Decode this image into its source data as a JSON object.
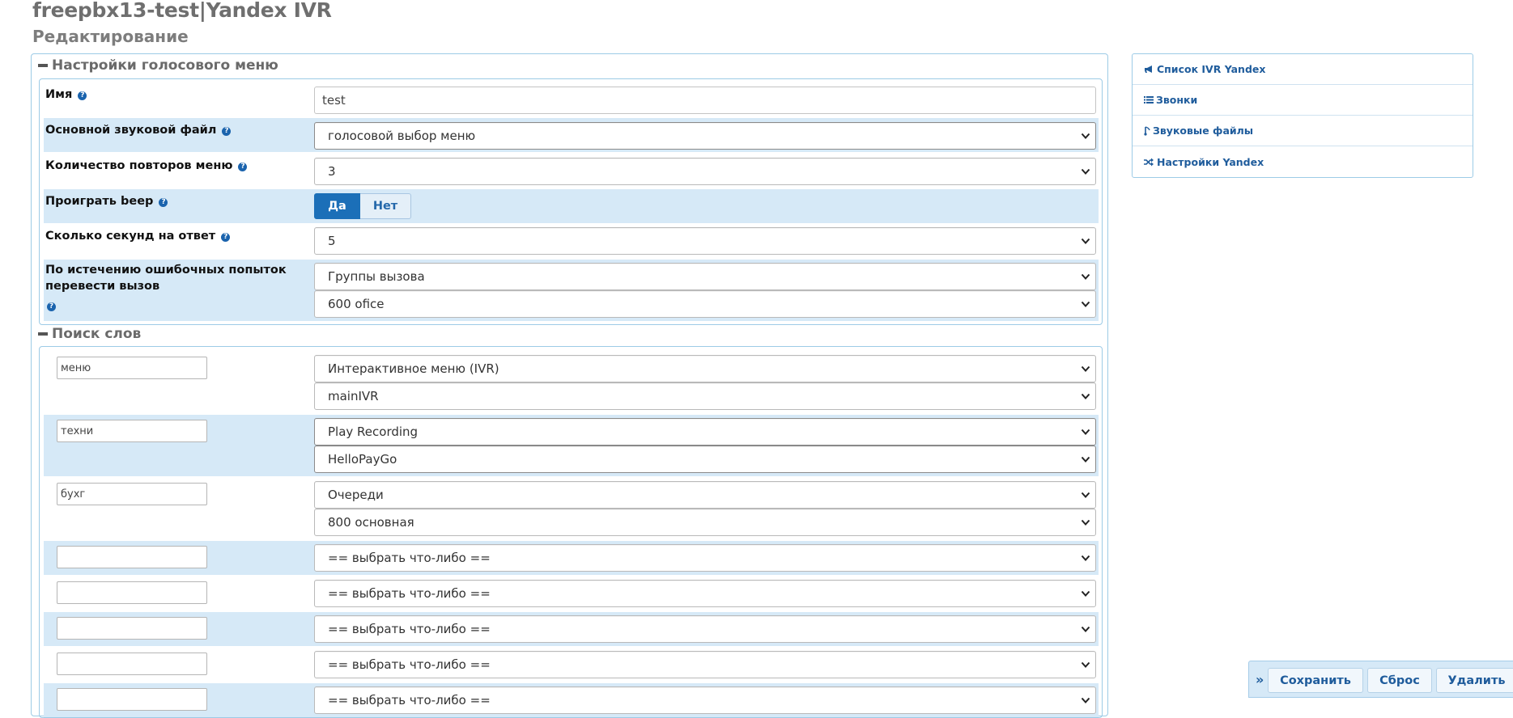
{
  "header": {
    "title": "freepbx13-test|Yandex IVR",
    "subtitle": "Редактирование"
  },
  "settings": {
    "legend": "Настройки голосового меню",
    "name_label": "Имя",
    "name_value": "test",
    "sound_label": "Основной звуковой файл",
    "sound_value": "голосовой выбор меню",
    "repeats_label": "Количество повторов меню",
    "repeats_value": "3",
    "beep_label": "Проиграть beep",
    "beep_yes": "Да",
    "beep_no": "Нет",
    "beep_selected": "Да",
    "timeout_label": "Сколько секунд на ответ",
    "timeout_value": "5",
    "failover_label_line1": "По истечению ошибочных попыток",
    "failover_label_line2": "перевести вызов",
    "failover_type": "Группы вызова",
    "failover_target": "600 ofice"
  },
  "words": {
    "legend": "Поиск слов",
    "items": [
      {
        "word": "меню",
        "type": "Интерактивное меню (IVR)",
        "target": "mainIVR"
      },
      {
        "word": "техни",
        "type": "Play Recording",
        "target": "HelloPayGo"
      },
      {
        "word": "бухг",
        "type": "Очереди",
        "target": "800 основная"
      },
      {
        "word": "",
        "type": "== выбрать что-либо =="
      },
      {
        "word": "",
        "type": "== выбрать что-либо =="
      },
      {
        "word": "",
        "type": "== выбрать что-либо =="
      },
      {
        "word": "",
        "type": "== выбрать что-либо =="
      },
      {
        "word": "",
        "type": "== выбрать что-либо =="
      }
    ]
  },
  "sidebar": {
    "items": [
      {
        "label": "Список IVR Yandex",
        "icon": "bullhorn-icon"
      },
      {
        "label": "Звонки",
        "icon": "list-icon"
      },
      {
        "label": "Звуковые файлы",
        "icon": "music-note-icon"
      },
      {
        "label": "Настройки Yandex",
        "icon": "random-icon"
      }
    ]
  },
  "actions": {
    "save": "Сохранить",
    "reset": "Сброс",
    "delete": "Удалить"
  },
  "colors": {
    "accent": "#1b6fb8",
    "row_alt": "#d6e9f7",
    "border": "#9dcbe6",
    "link": "#1f5c9c"
  }
}
